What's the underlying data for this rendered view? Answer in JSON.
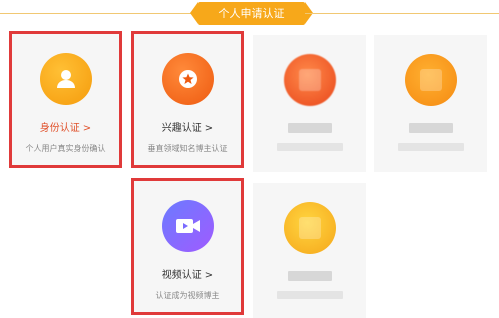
{
  "header": {
    "title": "个人申请认证"
  },
  "cards": [
    {
      "title": "身份认证",
      "chevron": ">",
      "desc": "个人用户真实身份确认",
      "icon": "person-icon",
      "color": "#f59b0c"
    },
    {
      "title": "兴趣认证",
      "chevron": ">",
      "desc": "垂直领域知名博主认证",
      "icon": "star-icon",
      "color": "#ee5a10"
    },
    {
      "title": "",
      "desc": "",
      "icon": "blurred-icon"
    },
    {
      "title": "",
      "desc": "",
      "icon": "blurred-icon"
    },
    {
      "title": "视频认证",
      "chevron": ">",
      "desc": "认证成为视频博主",
      "icon": "video-camera-icon",
      "color": "#7a6bff"
    },
    {
      "title": "",
      "desc": "",
      "icon": "blurred-icon"
    }
  ],
  "colors": {
    "accent": "#f7a81a",
    "highlight_border": "#e03a3a"
  }
}
